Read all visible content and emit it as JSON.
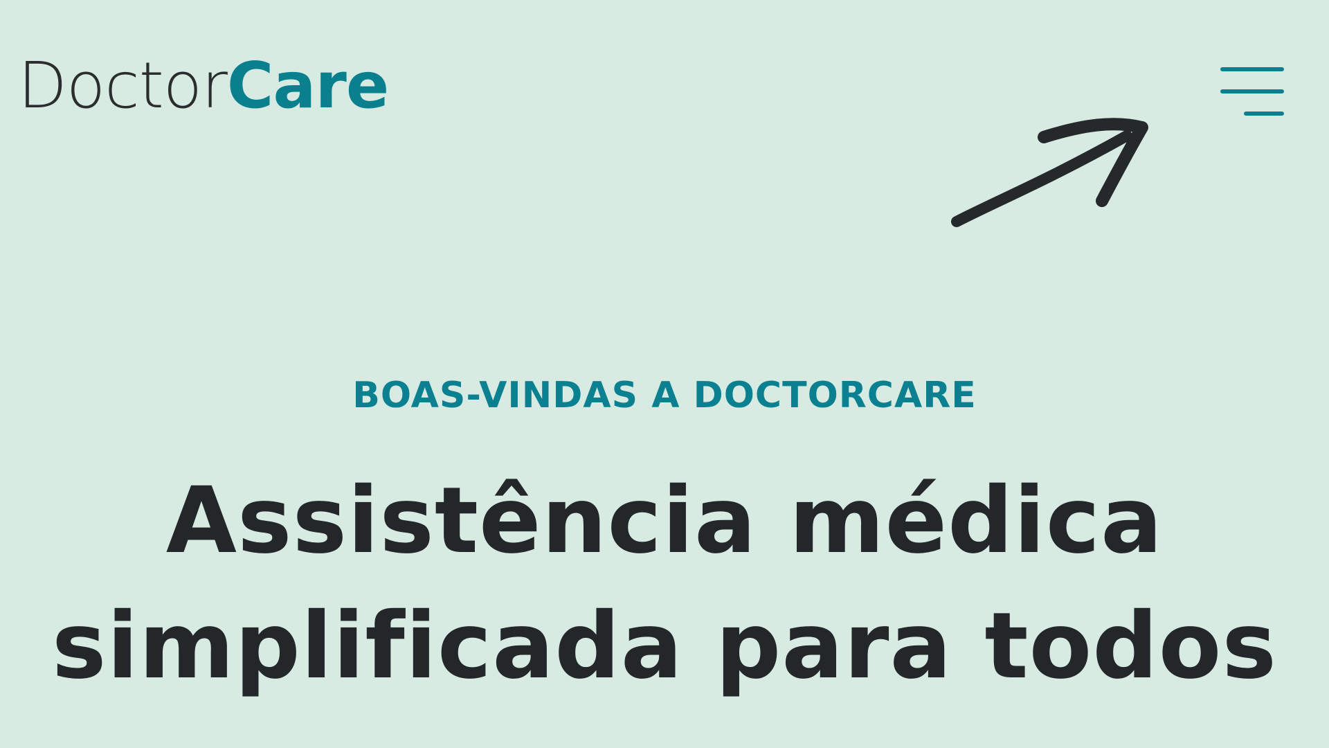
{
  "brand": {
    "logo_part_1": "Doctor",
    "logo_part_2": "Care"
  },
  "header": {
    "menu_icon": "hamburger-menu-icon"
  },
  "annotation": {
    "icon": "pointing-arrow-icon"
  },
  "hero": {
    "eyebrow": "BOAS-VINDAS A DOCTORCARE",
    "headline_line_1": "Assistência médica",
    "headline_line_2": "simplificada para todos"
  },
  "colors": {
    "background": "#d8ebe2",
    "accent": "#0a7f8e",
    "text": "#262a2d",
    "annotation_arrow": "#26292b"
  }
}
